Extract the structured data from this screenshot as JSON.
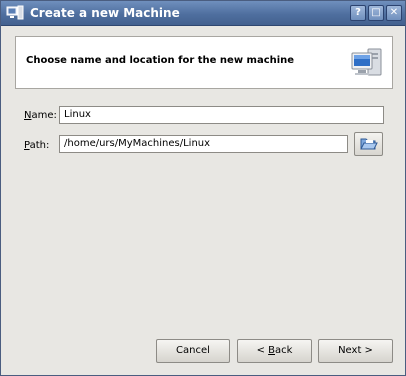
{
  "window": {
    "title": "Create a new Machine",
    "title_icon": "computer-icon",
    "buttons": {
      "help": "?",
      "maximize": "□",
      "close": "✕"
    }
  },
  "header": {
    "text": "Choose name and location for the new machine",
    "icon": "computer-monitor-icon"
  },
  "form": {
    "name": {
      "label_accel": "N",
      "label_rest": "ame:",
      "value": "Linux"
    },
    "path": {
      "label_accel": "P",
      "label_rest": "ath:",
      "value": "/home/urs/MyMachines/Linux",
      "browse_icon": "folder-open-icon"
    }
  },
  "footer": {
    "cancel": "Cancel",
    "back_pre": "< ",
    "back_accel": "B",
    "back_rest": "ack",
    "next": "Next >"
  }
}
